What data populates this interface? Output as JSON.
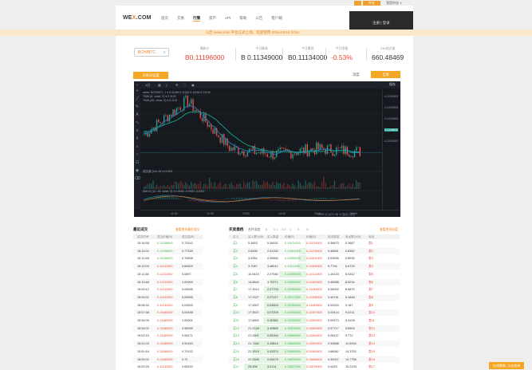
{
  "topbar": {
    "lang": "中文",
    "account": "我是你爸 ∨"
  },
  "header": {
    "logo": {
      "main": "WE",
      "x": "X",
      "rest": ".COM"
    },
    "nav": [
      "首页",
      "交易",
      "行情",
      "资产",
      "API",
      "帮助",
      "公告",
      "客户端"
    ],
    "active_nav": 2,
    "user": "注册 | 登录"
  },
  "notice": "公告 weex.com 平台正式上线，欢迎使用 2018-03-16 2018",
  "pair": {
    "name": "BCH/BTC",
    "caret": "∨"
  },
  "stats": [
    {
      "label": "最新价",
      "value": "B0.11196000",
      "color": "red"
    },
    {
      "label": "今日最高",
      "value": "B 0.11349000",
      "color": "normal"
    },
    {
      "label": "今日最低",
      "value": "B0.11134000",
      "color": "normal"
    },
    {
      "label": "今日涨幅",
      "value": "-0.53%",
      "color": "red"
    },
    {
      "label": "24H成交量",
      "value": "660.48469",
      "color": "normal"
    }
  ],
  "buttons": {
    "fav": "交易对设置",
    "depth": "深度",
    "fullscreen": "全屏"
  },
  "chart_toolbar": {
    "interval": "1分",
    "save": "保存"
  },
  "chart_legend": {
    "line1": "weex: BCH/BTC, 1 ▾  0.11196 0.11196 0.11196 0.11196",
    "line2": "T/MA (9, close, 0) ▾  0.1120",
    "line3": "T/MA (30, close, 0) ▾  0.1119",
    "vol": "成交量 (Vol, 20) ▾  0.000",
    "macd": "MACD (12, 26, close, 9) ▾  0.0000  -0.0000  -0.0000"
  },
  "chart_axis": {
    "y": [
      "0.11350000",
      "0.11300000",
      "0.11250000",
      "0.11196000",
      "0.11150000"
    ],
    "x": [
      "11:00",
      "12:00",
      "13:00",
      "14:00",
      "15:00",
      "16:00"
    ],
    "footer": "15:19:11 (UTC+8)  %  自动 | 日志"
  },
  "chart_data": {
    "type": "line",
    "x": [
      "11:00",
      "12:00",
      "13:00",
      "14:00",
      "15:00",
      "16:00"
    ],
    "series": [
      {
        "name": "BCH/BTC",
        "values": [
          0.1126,
          0.1138,
          0.1121,
          0.1119,
          0.1121,
          0.112
        ]
      },
      {
        "name": "T/MA (9, close, 0)",
        "values": [
          0.1127,
          0.1135,
          0.1123,
          0.112,
          0.112,
          0.112
        ]
      },
      {
        "name": "T/MA (30, close, 0)",
        "values": [
          0.1129,
          0.1134,
          0.1125,
          0.1121,
          0.112,
          0.1119
        ]
      }
    ],
    "ylim": [
      0.1113,
      0.114
    ],
    "colors": {
      "price": "#e67e22",
      "ma9": "#2980b9",
      "ma30": "#17a589",
      "up": "#26a69a",
      "down": "#ef5350"
    }
  },
  "recent_trades": {
    "title": "最近成交",
    "link": "查看更多最近成交",
    "headers": [
      "成交时间",
      "成交价格(B)",
      "成交量(B)"
    ],
    "rows": [
      [
        "15:14:58",
        "0.11196000",
        "0.73242",
        "g"
      ],
      [
        "15:13:34",
        "0.11196000",
        "0.77339",
        "g"
      ],
      [
        "15:12:48",
        "0.11196000",
        "0.70838",
        "g"
      ],
      [
        "15:12:09",
        "0.11211000",
        "0.60829",
        "r"
      ],
      [
        "15:11:38",
        "0.11211000",
        "0.0897",
        "r"
      ],
      [
        "15:10:48",
        "0.11211000",
        "1.00909",
        "r"
      ],
      [
        "15:09:12",
        "0.11211000",
        "0.03535",
        "r"
      ],
      [
        "15:09:02",
        "0.11211000",
        "0.00655",
        "r"
      ],
      [
        "15:08:34",
        "0.11211000",
        "0.02605",
        "r"
      ],
      [
        "15:07:38",
        "0.11180000",
        "0.04348",
        "r"
      ],
      [
        "15:04:05",
        "0.11180000",
        "1.00001",
        "r"
      ],
      [
        "15:04:02",
        "0.11180000",
        "0.96289",
        "r"
      ],
      [
        "15:02:15",
        "0.11180000",
        "0.08171",
        "r"
      ],
      [
        "15:01:03",
        "0.11180000",
        "0.94163",
        "r"
      ],
      [
        "15:00:16",
        "0.11180000",
        "0.70132",
        "r"
      ],
      [
        "15:00:02",
        "0.11180000",
        "0.72",
        "r"
      ],
      [
        "15:09:25",
        "0.11211000",
        "0.65102",
        "r"
      ]
    ]
  },
  "orderbook": {
    "title": "买卖盘档",
    "depth_label": "合并深度",
    "depths": [
      "8",
      "0.1",
      "0.5",
      "1",
      "5",
      "10"
    ],
    "link": "查看更多挂盘",
    "headers": [
      "买入",
      "买入累计(B)",
      "买入数量",
      "价格(B)",
      "价格(B)",
      "卖出数量",
      "卖出累计(B)",
      "卖出"
    ],
    "rows": [
      [
        "买1",
        "0.3453",
        "0.34531",
        "0.11074000",
        "0.11216000",
        "0.36873",
        "0.3687",
        "卖1"
      ],
      [
        "买2",
        "2.8336",
        "2.51332",
        "0.11061000",
        "0.11215000",
        "0.46651",
        "0.8352",
        "卖2"
      ],
      [
        "买3",
        "3.2284",
        "0.39484",
        "0.11055000",
        "0.11301000",
        "0.03635",
        "0.8935",
        "卖3"
      ],
      [
        "买4",
        "3.7087",
        "3.48011",
        "0.11011000",
        "0.11405000",
        "5.7794",
        "6.6729",
        "卖4"
      ],
      [
        "买5",
        "10.9415",
        "2.27082",
        "0.10995000",
        "0.11413000",
        "1.16133",
        "8.0342",
        "卖5"
      ],
      [
        "买6",
        "14.6842",
        "3.70271",
        "0.10992000",
        "0.11423000",
        "0.48988",
        "8.5234",
        "卖6"
      ],
      [
        "买7",
        "17.1614",
        "2.47704",
        "0.10988000",
        "0.11430000",
        "0.06052",
        "8.6875",
        "卖7"
      ],
      [
        "买8",
        "17.2327",
        "0.07117",
        "0.10972000",
        "0.11435000",
        "0.49741",
        "9.1848",
        "卖8"
      ],
      [
        "买9",
        "17.2807",
        "0.04803",
        "0.10951000",
        "0.11443000",
        "0.00224",
        "9.187",
        "卖9"
      ],
      [
        "买10",
        "17.3527",
        "0.07209",
        "0.10935000",
        "0.11497000",
        "0.03414",
        "9.2211",
        "卖10"
      ],
      [
        "买11",
        "17.6862",
        "0.40351",
        "0.10933000",
        "0.11500000",
        "0.09373",
        "9.3128",
        "卖11"
      ],
      [
        "买12",
        "21.2148",
        "3.40869",
        "0.10904000",
        "0.11550000",
        "0.37717",
        "9.6909",
        "卖12"
      ],
      [
        "买13",
        "21.2601",
        "0.05264",
        "0.10884000",
        "0.11553000",
        "0.08112",
        "9.772",
        "卖13"
      ],
      [
        "买14",
        "21.7182",
        "0.45819",
        "0.10840000",
        "0.11552000",
        "2.93588",
        "12.6934",
        "卖14"
      ],
      [
        "买15",
        "22.1519",
        "0.43374",
        "0.10889000",
        "0.11563000",
        "1.68082",
        "14.3752",
        "卖15"
      ],
      [
        "买16",
        "22.2466",
        "0.09479",
        "0.10833000",
        "0.11666000",
        "0.39047",
        "14.7756",
        "卖16"
      ],
      [
        "买17",
        "25.458",
        "3.2114",
        "0.10827000",
        "0.11675000",
        "0.4433",
        "15.2139",
        "卖17"
      ]
    ]
  },
  "chat": "在线客服, 点击咨询"
}
